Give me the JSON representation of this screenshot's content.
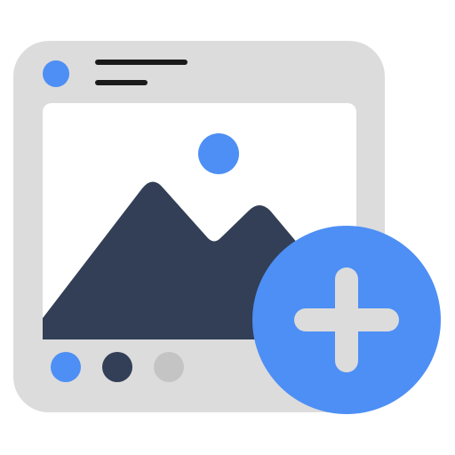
{
  "icon": {
    "name": "add-image-icon",
    "window": {
      "frame_color": "#dcdcdc",
      "canvas_color": "#ffffff",
      "title_dot_color": "#4d8ff5",
      "title_line_color": "#1a1a1a"
    },
    "image": {
      "sun_color": "#4d8ff5",
      "mountain_color": "#323f56"
    },
    "pagination": {
      "dots": [
        {
          "color": "#4d8ff5",
          "state": "active"
        },
        {
          "color": "#323f56",
          "state": "inactive"
        },
        {
          "color": "#c4c4c4",
          "state": "inactive"
        }
      ]
    },
    "add_badge": {
      "icon": "plus-icon",
      "circle_color": "#4d8ff5",
      "plus_color": "#dcdcdc"
    }
  }
}
